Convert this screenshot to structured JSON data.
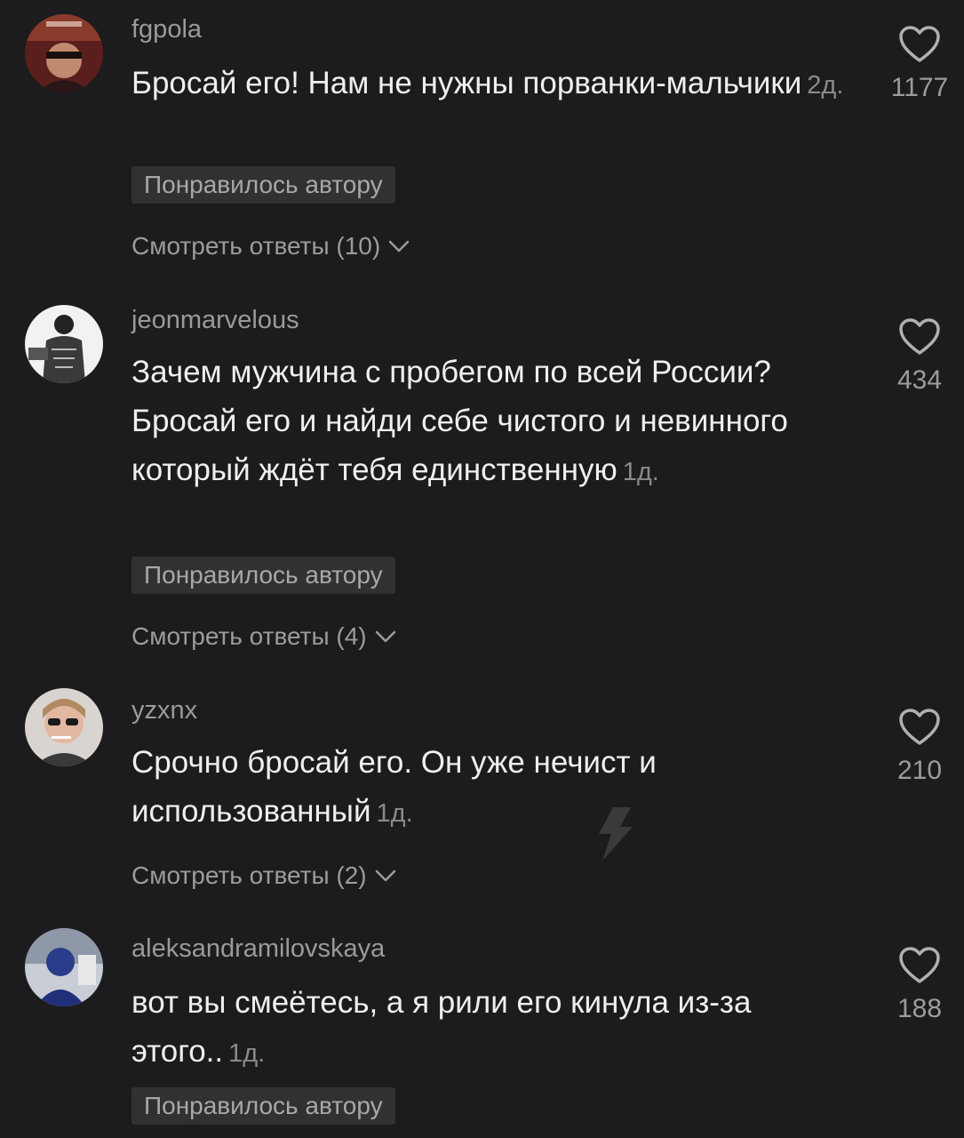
{
  "comments": [
    {
      "username": "fgpola",
      "text": "Бросай его! Нам не нужны порванки-мальчики",
      "time": "2д.",
      "liked_by_author": "Понравилось автору",
      "view_replies": "Смотреть ответы (10)",
      "likes": "1177"
    },
    {
      "username": "jeonmarvelous",
      "text": "Зачем мужчина с пробегом по всей России? Бросай его и найди себе чистого и невинного который ждёт тебя единственную",
      "time": "1д.",
      "liked_by_author": "Понравилось автору",
      "view_replies": "Смотреть ответы (4)",
      "likes": "434"
    },
    {
      "username": "yzxnx",
      "text": "Срочно бросай его. Он уже нечист и использованный",
      "time": "1д.",
      "view_replies": "Смотреть ответы (2)",
      "likes": "210"
    },
    {
      "username": "aleksandramilovskaya",
      "text": "вот вы смеётесь, а я рили его кинула из-за этого..",
      "time": "1д.",
      "liked_by_author": "Понравилось автору",
      "likes": "188"
    }
  ],
  "icons": {
    "like": "heart-outline-icon",
    "expand": "chevron-down-icon",
    "watermark": "lightning-bolt-icon"
  },
  "colors": {
    "background": "#1c1c1e",
    "text": "#efefef",
    "muted": "#9c9c9c",
    "badge": "#313131"
  }
}
